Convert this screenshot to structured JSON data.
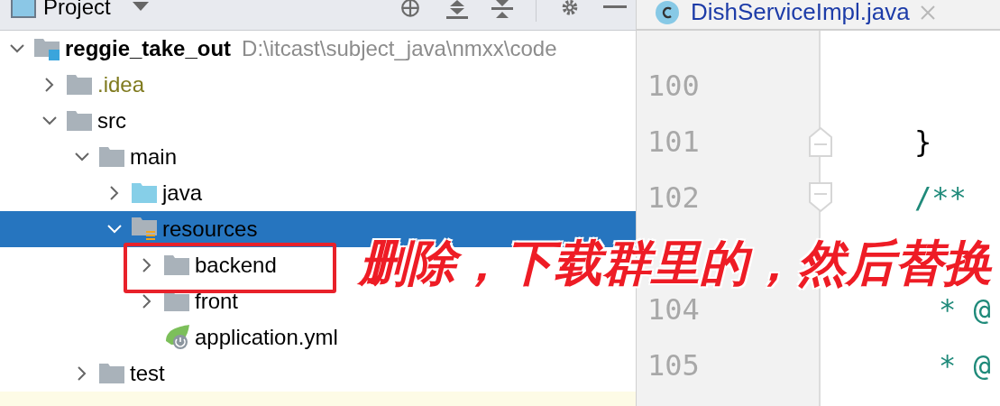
{
  "project_panel": {
    "title": "Project"
  },
  "tree": [
    {
      "label": "reggie_take_out",
      "kind": "module",
      "path": "D:\\itcast\\subject_java\\nmxx\\code",
      "expanded": true,
      "selected": false,
      "children": [
        {
          "label": ".idea",
          "kind": "ignored-folder",
          "expanded": false,
          "selected": false
        },
        {
          "label": "src",
          "kind": "folder",
          "expanded": true,
          "selected": false,
          "children": [
            {
              "label": "main",
              "kind": "folder",
              "expanded": true,
              "selected": false,
              "children": [
                {
                  "label": "java",
                  "kind": "source-folder",
                  "expanded": false,
                  "selected": false
                },
                {
                  "label": "resources",
                  "kind": "resource-folder",
                  "expanded": true,
                  "selected": true,
                  "children": [
                    {
                      "label": "backend",
                      "kind": "folder",
                      "expanded": false,
                      "selected": false
                    },
                    {
                      "label": "front",
                      "kind": "folder",
                      "expanded": false,
                      "selected": false
                    },
                    {
                      "label": "application.yml",
                      "kind": "yml-file",
                      "selected": false
                    }
                  ]
                }
              ]
            },
            {
              "label": "test",
              "kind": "folder",
              "expanded": false,
              "selected": false
            }
          ]
        }
      ]
    }
  ],
  "editor": {
    "tab": {
      "label": "DishServiceImpl.java",
      "selected": true
    },
    "lines": [
      {
        "number": "100",
        "fold_start": false,
        "fold_end": false
      },
      {
        "number": "101",
        "code": "}",
        "kind": "plain",
        "fold_start": false,
        "fold_end": true
      },
      {
        "number": "102",
        "code": "/**",
        "kind": "comment",
        "fold_start": true,
        "fold_end": false
      },
      {
        "number": "104",
        "code": "* @",
        "kind": "comment",
        "fold_start": false,
        "fold_end": false
      },
      {
        "number": "105",
        "code": "* @",
        "kind": "comment",
        "fold_start": false,
        "fold_end": false
      }
    ]
  },
  "annotation": {
    "text": "删除，下载群里的，然后替换"
  }
}
